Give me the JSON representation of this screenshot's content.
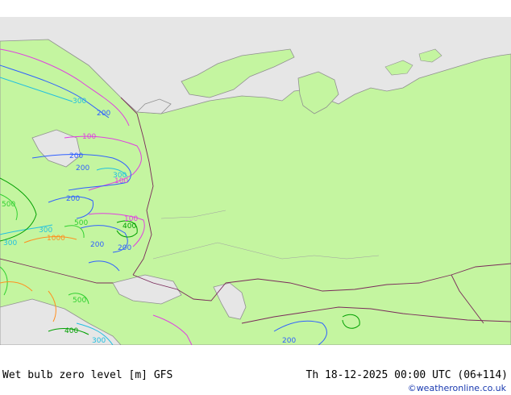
{
  "footer": {
    "title": "Wet bulb zero level [m] GFS",
    "datetime": "Th 18-12-2025 00:00 UTC (06+114)",
    "credit": "©weatheronline.co.uk"
  },
  "colors": {
    "sea": "#e6e6e6",
    "land": "#c4f5a0",
    "border": "#7a2a5a",
    "coast": "#909090",
    "c100": "#e040e0",
    "c200": "#3060ff",
    "c300": "#20c0e0",
    "c400": "#00a000",
    "c500": "#30d030",
    "c1000": "#ff9020"
  },
  "contour_labels": [
    {
      "text": "300",
      "color": "c300"
    },
    {
      "text": "200",
      "color": "c200"
    },
    {
      "text": "100",
      "color": "c100"
    },
    {
      "text": "200",
      "color": "c200"
    },
    {
      "text": "200",
      "color": "c200"
    },
    {
      "text": "300",
      "color": "c300"
    },
    {
      "text": "100",
      "color": "c100"
    },
    {
      "text": "200",
      "color": "c200"
    },
    {
      "text": "500",
      "color": "c500"
    },
    {
      "text": "100",
      "color": "c100"
    },
    {
      "text": "400",
      "color": "c400"
    },
    {
      "text": "500",
      "color": "c500"
    },
    {
      "text": "300",
      "color": "c300"
    },
    {
      "text": "1000",
      "color": "c1000"
    },
    {
      "text": "200",
      "color": "c200"
    },
    {
      "text": "200",
      "color": "c200"
    },
    {
      "text": "300",
      "color": "c300"
    },
    {
      "text": "500",
      "color": "c500"
    },
    {
      "text": "400",
      "color": "c400"
    },
    {
      "text": "300",
      "color": "c300"
    },
    {
      "text": "200",
      "color": "c200"
    }
  ]
}
